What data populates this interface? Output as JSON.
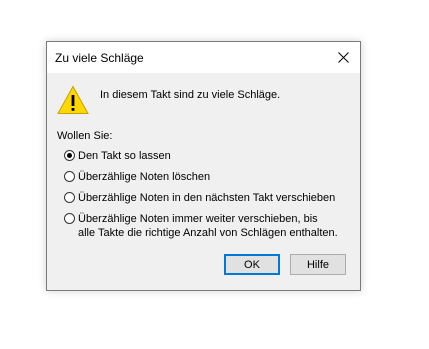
{
  "dialog": {
    "title": "Zu viele Schläge",
    "message": "In diesem Takt sind zu viele Schläge.",
    "prompt": "Wollen Sie:",
    "options": [
      {
        "label": "Den Takt so lassen",
        "selected": true
      },
      {
        "label": "Überzählige Noten löschen",
        "selected": false
      },
      {
        "label": "Überzählige Noten in den nächsten Takt verschieben",
        "selected": false
      },
      {
        "label_line1": "Überzählige Noten immer weiter verschieben, bis",
        "label_line2": "alle Takte die richtige Anzahl von Schlägen enthalten.",
        "selected": false
      }
    ],
    "ok_label": "OK",
    "help_label": "Hilfe",
    "icons": {
      "warning": "warning-icon",
      "close": "close-icon"
    },
    "colors": {
      "warning_fill": "#ffd800",
      "default_button_border": "#0078d7"
    }
  }
}
